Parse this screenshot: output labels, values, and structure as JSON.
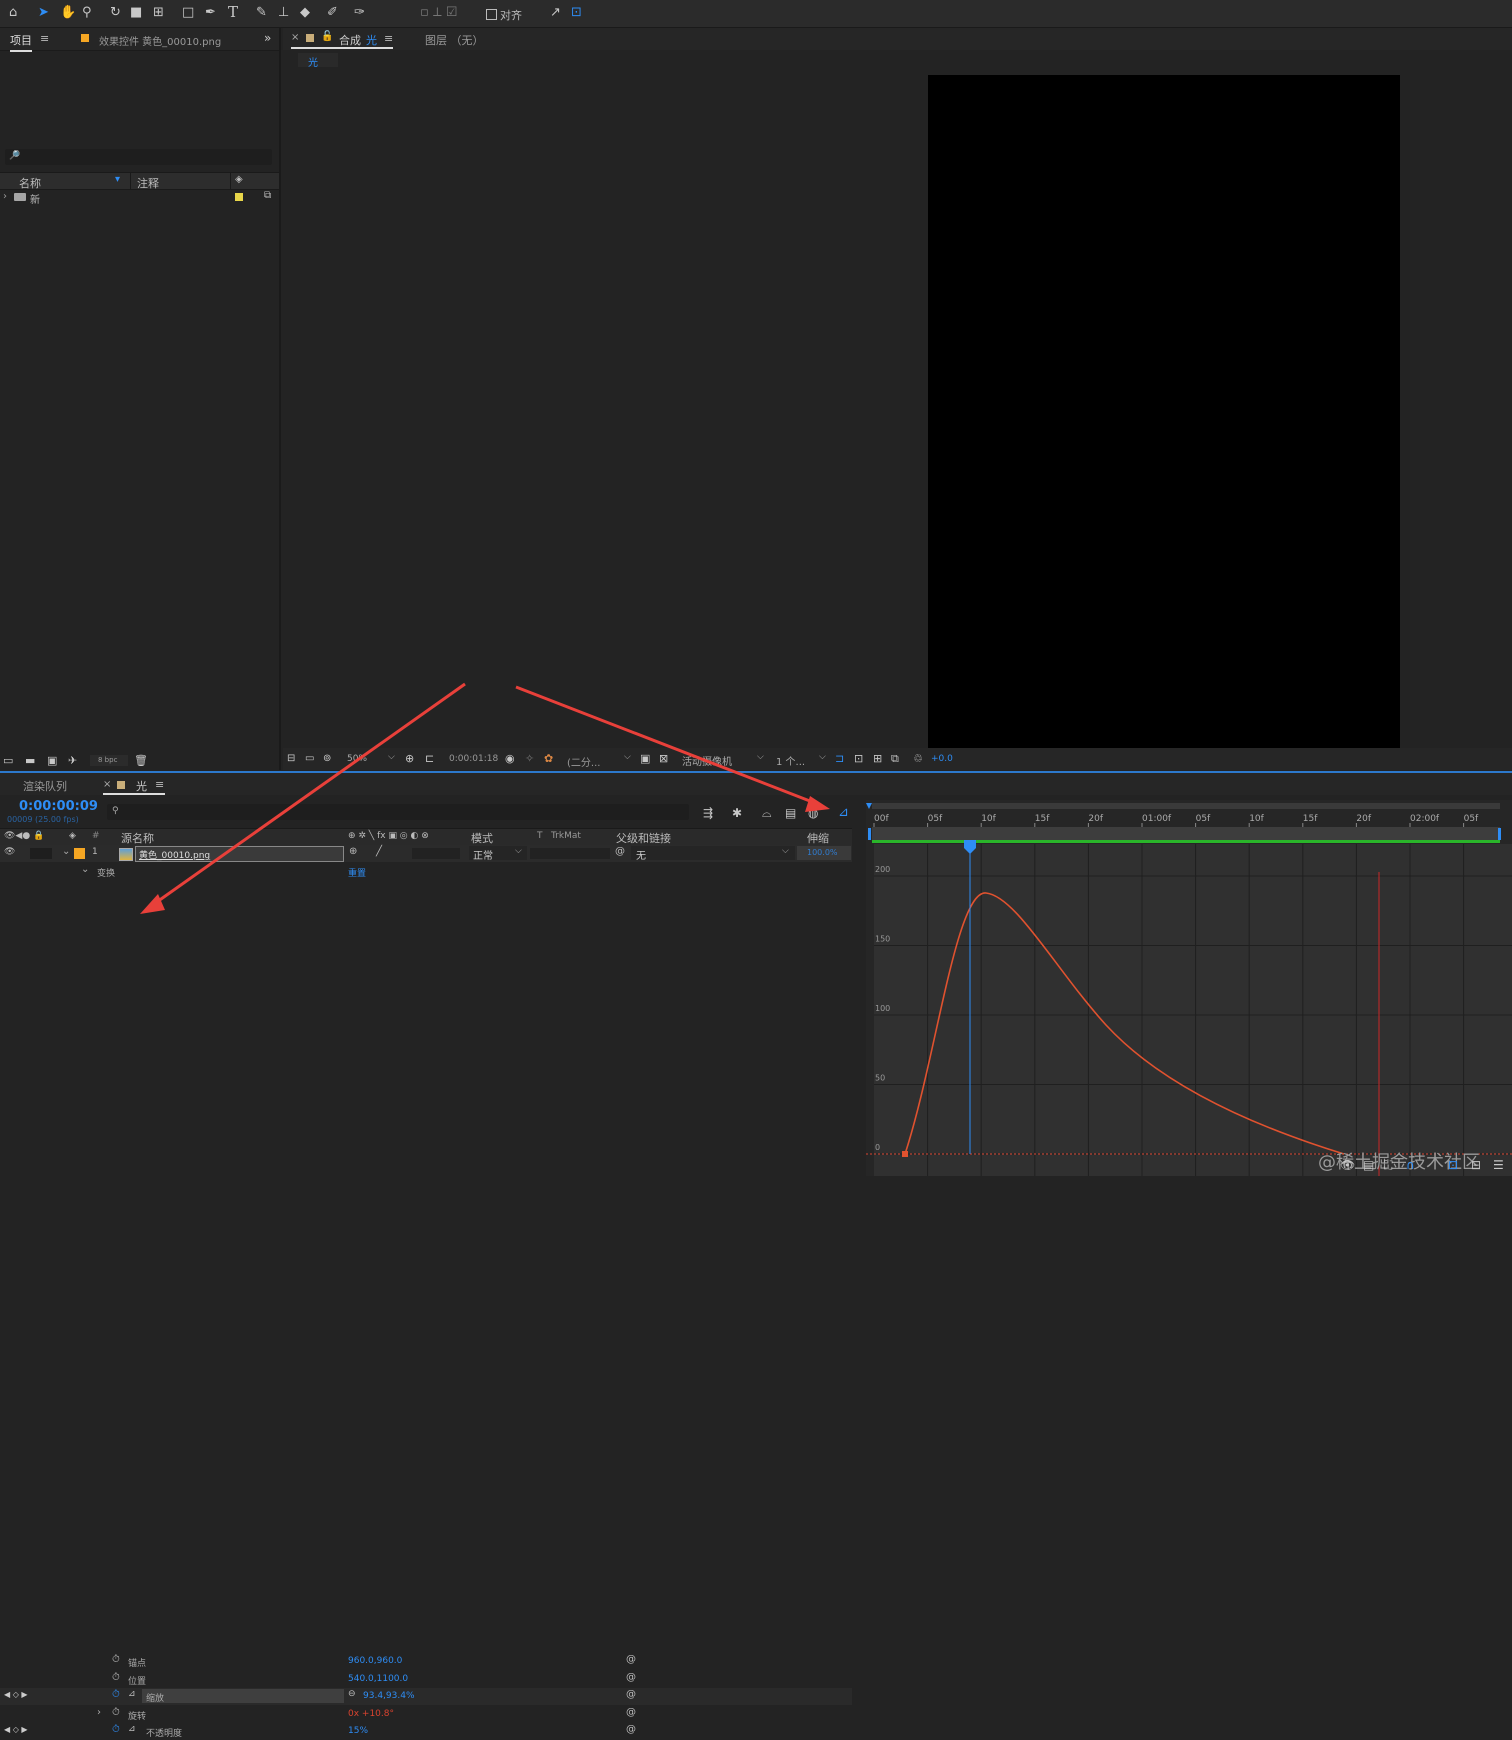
{
  "toolbar": {
    "snap_label": "对齐",
    "tools": [
      "home-icon",
      "selection-icon",
      "hand-icon",
      "zoom-icon",
      "rotate-icon",
      "camera-icon",
      "pan-behind-icon",
      "rectangle-icon",
      "pen-icon",
      "type-icon",
      "brush-icon",
      "clone-stamp-icon",
      "eraser-icon",
      "roto-brush-icon",
      "puppet-pin-icon"
    ]
  },
  "project_panel": {
    "tab_label": "项目",
    "effects_tab_label": "效果控件 黄色_00010.png",
    "search_icon": "🔎",
    "col_name": "名称",
    "col_comment": "注释",
    "folder_name": "新",
    "bpc": "8 bpc",
    "label_color": "#e8d64a"
  },
  "comp_panel": {
    "tab_prefix": "合成",
    "tab_name": "光",
    "layer_tab_label": "图层 （无）",
    "breadcrumb": "光",
    "zoom": "50%",
    "timecode": "0:00:01:18",
    "resolution": "(二分...",
    "camera": "活动摄像机",
    "views": "1 个...",
    "exposure": "+0.0"
  },
  "timeline": {
    "render_queue_tab": "渲染队列",
    "comp_tab": "光",
    "timecode": "0:00:00:09",
    "frame_info": "00009 (25.00 fps)",
    "headers": {
      "source_name": "源名称",
      "mode": "模式",
      "t": "T",
      "trkmat": "TrkMat",
      "parent": "父级和链接",
      "stretch": "伸缩"
    },
    "layer": {
      "number": "1",
      "name": "黄色_00010.png",
      "mode": "正常",
      "parent": "无",
      "stretch": "100.0%",
      "label_color": "#f5a623"
    },
    "transform_label": "变换",
    "reset_label": "重置",
    "properties": [
      {
        "name": "锚点",
        "value": "960.0,960.0"
      },
      {
        "name": "位置",
        "value": "540.0,1100.0"
      },
      {
        "name": "缩放",
        "value": "93.4,93.4%"
      },
      {
        "name": "旋转",
        "value": "0x +10.8°"
      },
      {
        "name": "不透明度",
        "value": "15%"
      }
    ],
    "ruler_labels": [
      "00f",
      "05f",
      "10f",
      "15f",
      "20f",
      "01:00f",
      "05f",
      "10f",
      "15f",
      "20f",
      "02:00f",
      "05f"
    ],
    "graph_y_labels": [
      "200",
      "150",
      "100",
      "50",
      "0"
    ],
    "watermark": "@稀土掘金技术社区"
  },
  "colors": {
    "accent": "#2e8df5",
    "curve": "#e0522f",
    "arrow": "#e8403a",
    "work_area": "#2ab52a"
  }
}
